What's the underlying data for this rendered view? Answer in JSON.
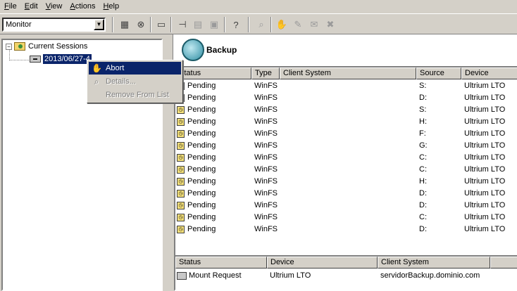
{
  "menu": [
    {
      "key": "F",
      "rest": "ile"
    },
    {
      "key": "E",
      "rest": "dit"
    },
    {
      "key": "V",
      "rest": "iew"
    },
    {
      "key": "A",
      "rest": "ctions"
    },
    {
      "key": "H",
      "rest": "elp"
    }
  ],
  "toolbar": {
    "view_select_value": "Monitor",
    "icons": [
      "sessions-icon",
      "stop-icon",
      "window-icon",
      "pin-icon",
      "grid-icon",
      "clipboard-icon",
      "help-icon",
      "search-icon",
      "hand-icon",
      "edit-icon",
      "mail-icon",
      "delete-icon"
    ]
  },
  "tree": {
    "root_label": "Current Sessions",
    "session_label": "2013/06/27-4"
  },
  "context_menu": {
    "abort": "Abort",
    "details": "Details...",
    "remove": "Remove From List"
  },
  "right": {
    "title": "Backup"
  },
  "table1": {
    "columns": [
      "Status",
      "Type",
      "Client System",
      "Source",
      "Device"
    ],
    "rows": [
      {
        "status": "Pending",
        "type": "WinFS",
        "client": "",
        "source": "S:",
        "device": "Ultrium LTO"
      },
      {
        "status": "Pending",
        "type": "WinFS",
        "client": "",
        "source": "D:",
        "device": "Ultrium LTO"
      },
      {
        "status": "Pending",
        "type": "WinFS",
        "client": "",
        "source": "S:",
        "device": "Ultrium LTO"
      },
      {
        "status": "Pending",
        "type": "WinFS",
        "client": "",
        "source": "H:",
        "device": "Ultrium LTO"
      },
      {
        "status": "Pending",
        "type": "WinFS",
        "client": "",
        "source": "F:",
        "device": "Ultrium LTO"
      },
      {
        "status": "Pending",
        "type": "WinFS",
        "client": "",
        "source": "G:",
        "device": "Ultrium LTO"
      },
      {
        "status": "Pending",
        "type": "WinFS",
        "client": "",
        "source": "C:",
        "device": "Ultrium LTO"
      },
      {
        "status": "Pending",
        "type": "WinFS",
        "client": "",
        "source": "C:",
        "device": "Ultrium LTO"
      },
      {
        "status": "Pending",
        "type": "WinFS",
        "client": "",
        "source": "H:",
        "device": "Ultrium LTO"
      },
      {
        "status": "Pending",
        "type": "WinFS",
        "client": "",
        "source": "D:",
        "device": "Ultrium LTO"
      },
      {
        "status": "Pending",
        "type": "WinFS",
        "client": "",
        "source": "D:",
        "device": "Ultrium LTO"
      },
      {
        "status": "Pending",
        "type": "WinFS",
        "client": "",
        "source": "C:",
        "device": "Ultrium LTO"
      },
      {
        "status": "Pending",
        "type": "WinFS",
        "client": "",
        "source": "D:",
        "device": "Ultrium LTO"
      }
    ]
  },
  "table2": {
    "columns": [
      "Status",
      "Device",
      "Client System"
    ],
    "rows": [
      {
        "status": "Mount Request",
        "device": "Ultrium LTO",
        "client": "servidorBackup.dominio.com"
      }
    ]
  },
  "colors": {
    "selection": "#0a246a",
    "face": "#d4d0c8"
  }
}
